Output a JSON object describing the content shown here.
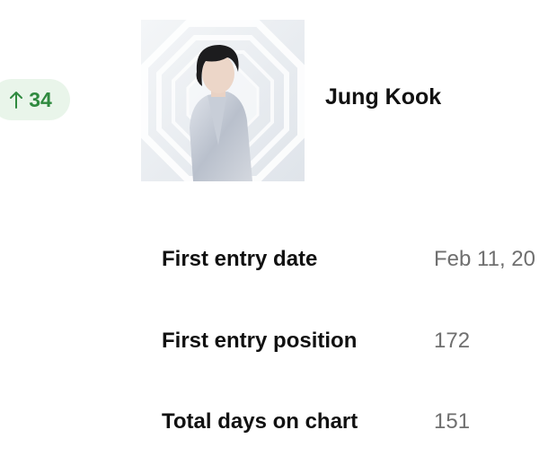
{
  "rank_change": {
    "arrow_icon": "arrow-up-icon",
    "value": "34",
    "color": "#2f8a3f",
    "background": "#e9f5ea"
  },
  "artist": {
    "name": "Jung Kook",
    "image_icon": "artist-photo"
  },
  "stats": [
    {
      "label": "First entry date",
      "value": "Feb 11, 20"
    },
    {
      "label": "First entry position",
      "value": "172"
    },
    {
      "label": "Total days on chart",
      "value": "151"
    }
  ]
}
